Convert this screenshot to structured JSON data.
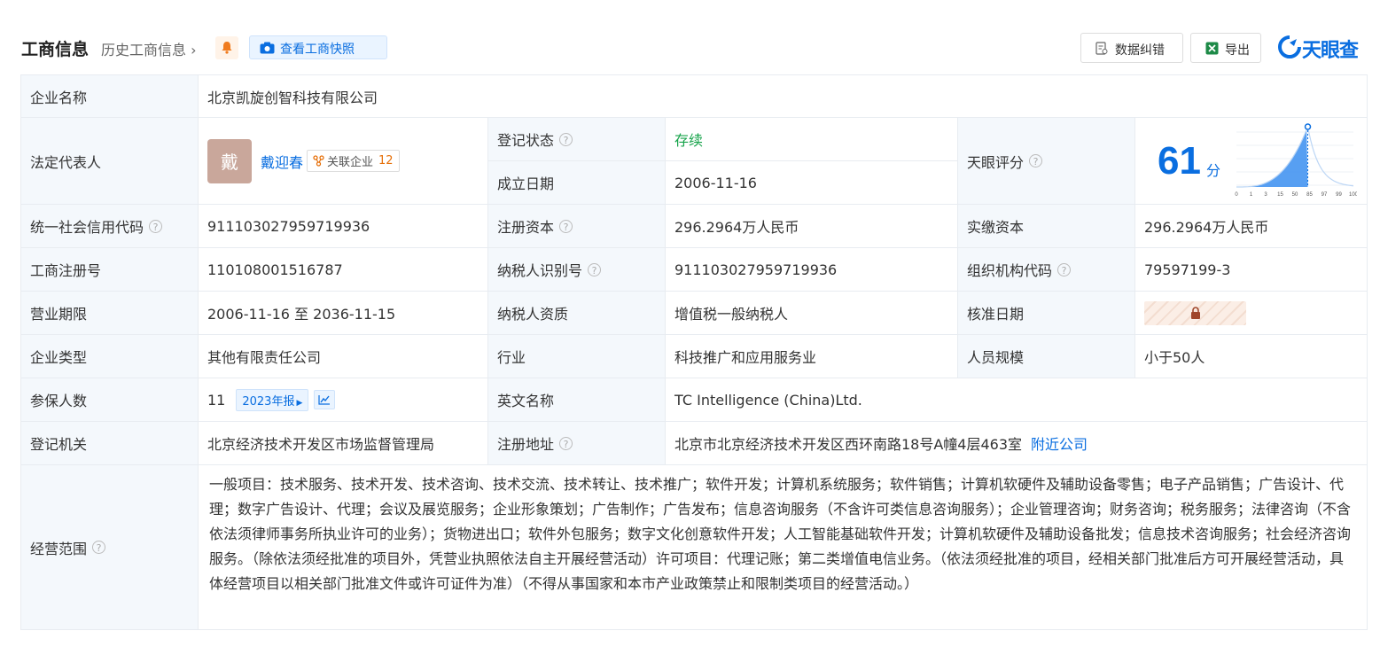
{
  "header": {
    "title": "工商信息",
    "history": "历史工商信息",
    "snapshot": "查看工商快照",
    "correct": "数据纠错",
    "export": "导出",
    "logo": "天眼查"
  },
  "rows": {
    "company_name": {
      "label": "企业名称",
      "value": "北京凯旋创智科技有限公司"
    },
    "legal": {
      "label": "法定代表人",
      "avatar": "戴",
      "name": "戴迎春",
      "rel_label": "关联企业",
      "rel_count": "12"
    },
    "reg_status": {
      "label": "登记状态",
      "value": "存续"
    },
    "found_date": {
      "label": "成立日期",
      "value": "2006-11-16"
    },
    "score": {
      "label": "天眼评分",
      "value": "61",
      "unit": "分",
      "axis_ticks": [
        "0",
        "1",
        "3",
        "15",
        "50",
        "85",
        "97",
        "99",
        "100"
      ],
      "fraction": 0.61
    },
    "credit_code": {
      "label": "统一社会信用代码",
      "value": "911103027959719936"
    },
    "reg_capital": {
      "label": "注册资本",
      "value": "296.2964万人民币"
    },
    "paid_capital": {
      "label": "实缴资本",
      "value": "296.2964万人民币"
    },
    "reg_no": {
      "label": "工商注册号",
      "value": "110108001516787"
    },
    "taxpayer_id": {
      "label": "纳税人识别号",
      "value": "911103027959719936"
    },
    "org_code": {
      "label": "组织机构代码",
      "value": "79597199-3"
    },
    "term": {
      "label": "营业期限",
      "value": "2006-11-16 至 2036-11-15"
    },
    "tax_quality": {
      "label": "纳税人资质",
      "value": "增值税一般纳税人"
    },
    "approve_date": {
      "label": "核准日期"
    },
    "type": {
      "label": "企业类型",
      "value": "其他有限责任公司"
    },
    "industry": {
      "label": "行业",
      "value": "科技推广和应用服务业"
    },
    "staff": {
      "label": "人员规模",
      "value": "小于50人"
    },
    "insured": {
      "label": "参保人数",
      "value": "11",
      "report": "2023年报"
    },
    "english": {
      "label": "英文名称",
      "value": "TC Intelligence (China)Ltd."
    },
    "authority": {
      "label": "登记机关",
      "value": "北京经济技术开发区市场监督管理局"
    },
    "address": {
      "label": "注册地址",
      "value": "北京市北京经济技术开发区西环南路18号A幢4层463室",
      "nearby": "附近公司"
    },
    "scope": {
      "label": "经营范围",
      "value": "一般项目：技术服务、技术开发、技术咨询、技术交流、技术转让、技术推广；软件开发；计算机系统服务；软件销售；计算机软硬件及辅助设备零售；电子产品销售；广告设计、代理；数字广告设计、代理；会议及展览服务；企业形象策划；广告制作；广告发布；信息咨询服务（不含许可类信息咨询服务）；企业管理咨询；财务咨询；税务服务；法律咨询（不含依法须律师事务所执业许可的业务）；货物进出口；软件外包服务；数字文化创意软件开发；人工智能基础软件开发；计算机软硬件及辅助设备批发；信息技术咨询服务；社会经济咨询服务。（除依法须经批准的项目外，凭营业执照依法自主开展经营活动）许可项目：代理记账；第二类增值电信业务。（依法须经批准的项目，经相关部门批准后方可开展经营活动，具体经营项目以相关部门批准文件或许可证件为准）（不得从事国家和本市产业政策禁止和限制类项目的经营活动。）"
    }
  },
  "colors": {
    "accent": "#0a6ee0",
    "status_green": "#16a34a",
    "label_bg": "#f4f8fc"
  }
}
